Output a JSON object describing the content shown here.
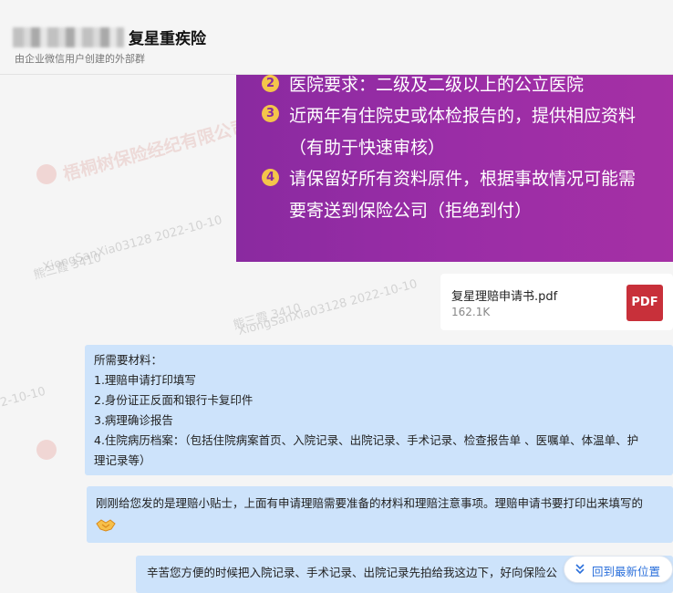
{
  "header": {
    "title": "复星重疾险",
    "subtitle": "由企业微信用户创建的外部群"
  },
  "watermarks": {
    "company": "梧桐树保险经纪有限公司",
    "user_line": "熊三霞 3410",
    "id_line": "XiongSanXia03128 2022-10-10",
    "partial_date": "2-10-10"
  },
  "image_content": {
    "items": [
      {
        "num": "2",
        "text": "医院要求：二级及二级以上的公立医院"
      },
      {
        "num": "3",
        "text": "近两年有住院史或体检报告的，提供相应资料"
      },
      {
        "num": "",
        "text": "（有助于快速审核）"
      },
      {
        "num": "4",
        "text": "请保留好所有资料原件，根据事故情况可能需"
      },
      {
        "num": "",
        "text": "要寄送到保险公司（拒绝到付）"
      }
    ]
  },
  "file": {
    "name": "复星理赔申请书.pdf",
    "size": "162.1K",
    "type_label": "PDF"
  },
  "messages": {
    "m1": {
      "lines": [
        "所需要材料：",
        "1.理赔申请打印填写",
        "2.身份证正反面和银行卡复印件",
        "3.病理确诊报告",
        "4.住院病历档案：（包括住院病案首页、入院记录、出院记录、手术记录、检查报告单 、医嘱单、体温单、护",
        "理记录等）"
      ]
    },
    "m2": {
      "text": "刚刚给您发的是理赔小贴士，上面有申请理赔需要准备的材料和理赔注意事项。理赔申请书要打印出来填写的"
    },
    "m3": {
      "text": "辛苦您方便的时候把入院记录、手术记录、出院记录先拍给我这边下，好向保险公"
    }
  },
  "jump_button": {
    "label": "回到最新位置"
  },
  "colors": {
    "bubble": "#cde3fb",
    "purple": "#9a2da6",
    "accent": "#2a6fdb",
    "pdf": "#c8303a"
  }
}
